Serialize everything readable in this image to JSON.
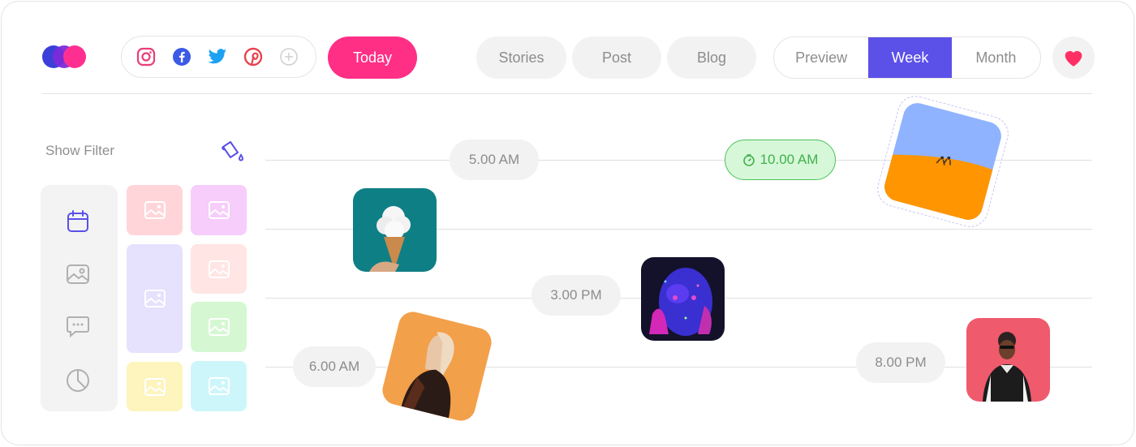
{
  "logo": {
    "name": "brand-logo"
  },
  "social": {
    "icons": [
      "instagram-icon",
      "facebook-icon",
      "twitter-icon",
      "pinterest-icon",
      "add-icon"
    ],
    "colors": {
      "instagram": "#ea3d7a",
      "facebook": "#3b5ae6",
      "twitter": "#1da1f2",
      "pinterest": "#e8434f",
      "add": "#cfcfcf"
    }
  },
  "toolbar": {
    "today_label": "Today",
    "tabs": [
      "Stories",
      "Post",
      "Blog"
    ],
    "view_options": [
      "Preview",
      "Week",
      "Month"
    ],
    "active_view": "Week"
  },
  "filter": {
    "label": "Show Filter"
  },
  "sidebar_icons": [
    "calendar-icon",
    "image-icon",
    "chat-icon",
    "pie-chart-icon"
  ],
  "timeline": {
    "times": [
      "5.00 AM",
      "10.00 AM",
      "3.00 PM",
      "6.00 AM",
      "8.00 PM"
    ],
    "active_time": "10.00 AM"
  },
  "colors": {
    "accent_pink": "#ff2f86",
    "accent_purple": "#5b50e8",
    "active_green": "#3fb24b"
  }
}
